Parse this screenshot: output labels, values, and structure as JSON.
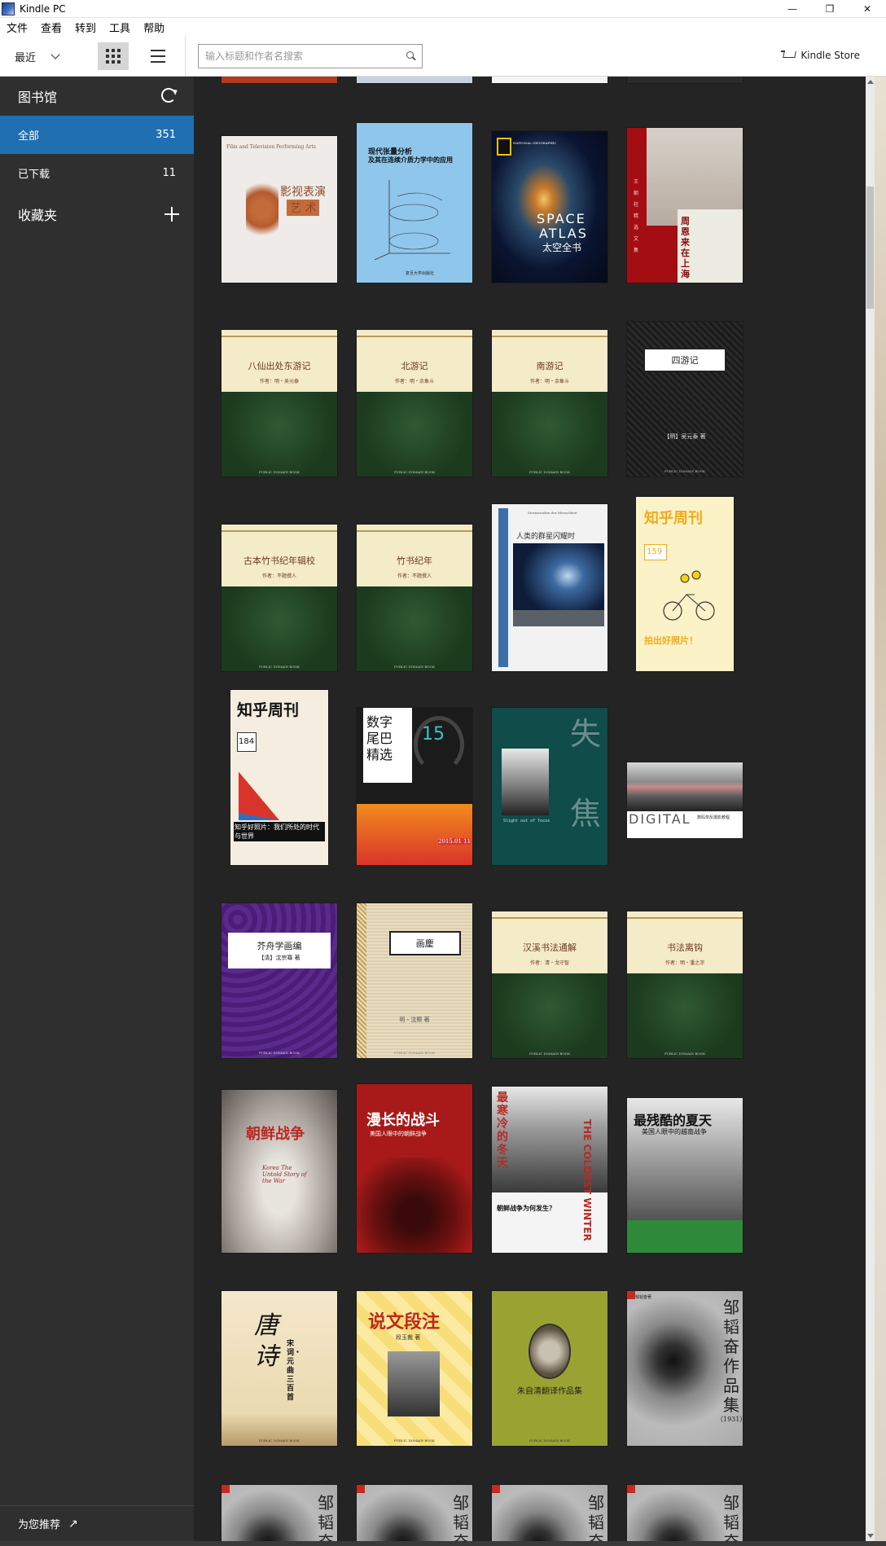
{
  "window": {
    "title": "Kindle PC",
    "minimize": "—",
    "maximize": "❐",
    "close": "✕"
  },
  "menu": [
    "文件",
    "查看",
    "转到",
    "工具",
    "帮助"
  ],
  "toolbar": {
    "sort": "最近",
    "search_placeholder": "输入标题和作者名搜索",
    "store": "Kindle Store"
  },
  "sidebar": {
    "library": "图书馆",
    "items": [
      {
        "label": "全部",
        "count": "351"
      },
      {
        "label": "已下载",
        "count": "11"
      }
    ],
    "collections": "收藏夹",
    "recommend": "为您推荐",
    "recommend_arrow": "↗"
  },
  "books": [
    {
      "id": "b1",
      "title_lines": [
        "影视表演",
        "艺 术"
      ],
      "subtitle": "Film and Television Performing Arts"
    },
    {
      "id": "b2",
      "title_lines": [
        "现代张量分析",
        "及其在连续介质力学中的应用"
      ],
      "subtitle": "复旦大学出版社"
    },
    {
      "id": "b3",
      "title_lines": [
        "SPACE",
        "ATLAS",
        "太空全书"
      ],
      "subtitle": "NATIONAL GEOGRAPHIC"
    },
    {
      "id": "b4",
      "title_lines": [
        "周恩来在上海"
      ],
      "subtitle": "王 朝 柱 精 选 文 集"
    },
    {
      "id": "b5",
      "title_lines": [
        "八仙出处东游记"
      ],
      "subtitle": "作者：明・吴元泰",
      "pd": "PUBLIC DOMAIN BOOK"
    },
    {
      "id": "b6",
      "title_lines": [
        "北游记"
      ],
      "subtitle": "作者：明・余象斗",
      "pd": "PUBLIC DOMAIN BOOK"
    },
    {
      "id": "b7",
      "title_lines": [
        "南游记"
      ],
      "subtitle": "作者：明・余象斗",
      "pd": "PUBLIC DOMAIN BOOK"
    },
    {
      "id": "b8",
      "title_lines": [
        "四游记"
      ],
      "subtitle": "【明】吴元泰 著",
      "pd": "PUBLIC DOMAIN BOOK"
    },
    {
      "id": "b9",
      "title_lines": [
        "古本竹书纪年辑校"
      ],
      "subtitle": "作者：不题撰人",
      "pd": "PUBLIC DOMAIN BOOK"
    },
    {
      "id": "b10",
      "title_lines": [
        "竹书纪年"
      ],
      "subtitle": "作者：不题撰人",
      "pd": "PUBLIC DOMAIN BOOK"
    },
    {
      "id": "b11",
      "title_lines": [
        "人类的群星闪耀时"
      ],
      "subtitle": "Sternstunden der Menschheit"
    },
    {
      "id": "b12",
      "title_lines": [
        "知乎周刊"
      ],
      "issue": "159",
      "subtitle": "拍出好照片！"
    },
    {
      "id": "b13",
      "title_lines": [
        "知乎周刊"
      ],
      "issue": "184",
      "subtitle": "知乎好照片：我们所处的时代与世界"
    },
    {
      "id": "b14",
      "title_lines": [
        "数字",
        "尾巴",
        "精选"
      ],
      "issue": "15",
      "subtitle": "2015.01 11"
    },
    {
      "id": "b15",
      "title_lines": [
        "失",
        "焦"
      ],
      "subtitle": "Slight out of focus"
    },
    {
      "id": "b16",
      "title_lines": [
        "DIGITAL"
      ],
      "subtitle": "数码单反摄影教程"
    },
    {
      "id": "b17",
      "title_lines": [
        "芥舟学画编"
      ],
      "subtitle": "【清】沈宗骞 著",
      "pd": "PUBLIC DOMAIN BOOK"
    },
    {
      "id": "b18",
      "title_lines": [
        "画麈"
      ],
      "subtitle": "明・沈颢 著",
      "pd": "PUBLIC DOMAIN BOOK"
    },
    {
      "id": "b19",
      "title_lines": [
        "汉溪书法通解"
      ],
      "subtitle": "作者：清・戈守智",
      "pd": "PUBLIC DOMAIN BOOK"
    },
    {
      "id": "b20",
      "title_lines": [
        "书法离钩"
      ],
      "subtitle": "作者：明・潘之淙",
      "pd": "PUBLIC DOMAIN BOOK"
    },
    {
      "id": "b21",
      "title_lines": [
        "朝鲜战争"
      ],
      "subtitle": "Korea The Untold Story of the War"
    },
    {
      "id": "b22",
      "title_lines": [
        "漫长的战斗"
      ],
      "subtitle": "美国人眼中的朝鲜战争"
    },
    {
      "id": "b23",
      "title_lines": [
        "最寒冷的冬天",
        "THE COLDEST WINTER"
      ],
      "subtitle": "朝鲜战争为何发生？"
    },
    {
      "id": "b24",
      "title_lines": [
        "最残酷的夏天"
      ],
      "subtitle": "美国人眼中的越南战争"
    },
    {
      "id": "b25",
      "title_lines": [
        "唐诗",
        "宋词・元曲三百首"
      ],
      "subtitle": "PUBLIC DOMAIN BOOK"
    },
    {
      "id": "b26",
      "title_lines": [
        "说文段注"
      ],
      "subtitle": "段玉裁 著",
      "pd": "PUBLIC DOMAIN BOOK"
    },
    {
      "id": "b27",
      "title_lines": [
        "朱自清翻译作品集"
      ],
      "subtitle": "PUBLIC DOMAIN BOOK"
    },
    {
      "id": "b28",
      "title_lines": [
        "邹韬奋作品集",
        "（1931）"
      ],
      "subtitle": "邹韬奋著"
    },
    {
      "id": "b29",
      "title_lines": [
        "邹",
        "韬",
        "奋"
      ],
      "subtitle": ""
    },
    {
      "id": "b30",
      "title_lines": [
        "邹",
        "韬",
        "奋"
      ],
      "subtitle": ""
    },
    {
      "id": "b31",
      "title_lines": [
        "邹",
        "韬",
        "奋"
      ],
      "subtitle": ""
    },
    {
      "id": "b32",
      "title_lines": [
        "邹",
        "韬",
        "奋"
      ],
      "subtitle": ""
    }
  ]
}
